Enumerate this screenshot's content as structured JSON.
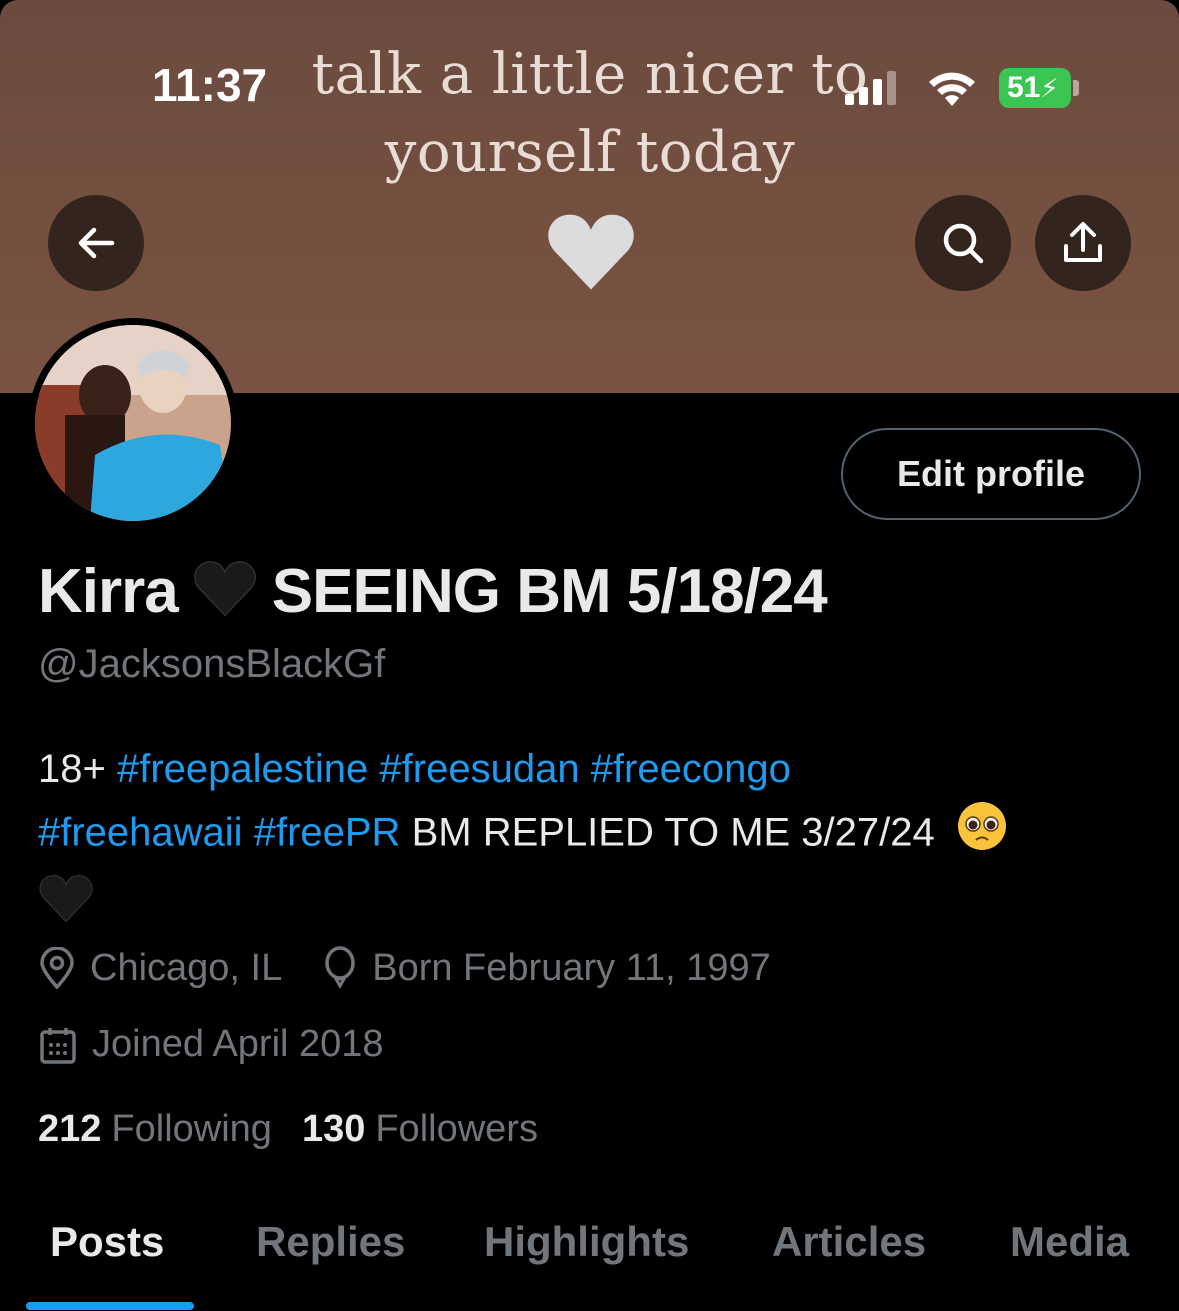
{
  "status_bar": {
    "time": "11:37",
    "battery": "51"
  },
  "banner": {
    "quote_line1": "talk a little nicer to",
    "quote_line2": "yourself today"
  },
  "nav": {
    "back_icon": "arrow-left-icon",
    "search_icon": "search-icon",
    "share_icon": "share-icon"
  },
  "profile": {
    "edit_label": "Edit profile",
    "name_first": "Kirra",
    "name_rest": "SEEING BM 5/18/24",
    "handle": "@JacksonsBlackGf",
    "bio": {
      "age": "18+",
      "tags_line1": [
        "#freepalestine",
        "#freesudan",
        "#freecongo"
      ],
      "tags_line2": [
        "#freehawaii",
        "#freePR"
      ],
      "text": "BM REPLIED TO ME 3/27/24"
    },
    "location": "Chicago, IL",
    "birthday": "Born February 11, 1997",
    "joined": "Joined April 2018",
    "following_count": "212",
    "following_label": "Following",
    "followers_count": "130",
    "followers_label": "Followers"
  },
  "tabs": [
    "Posts",
    "Replies",
    "Highlights",
    "Articles",
    "Media"
  ],
  "colors": {
    "accent": "#1d9bf0",
    "background": "#000000",
    "muted": "#71767b",
    "banner": "#74503f"
  }
}
